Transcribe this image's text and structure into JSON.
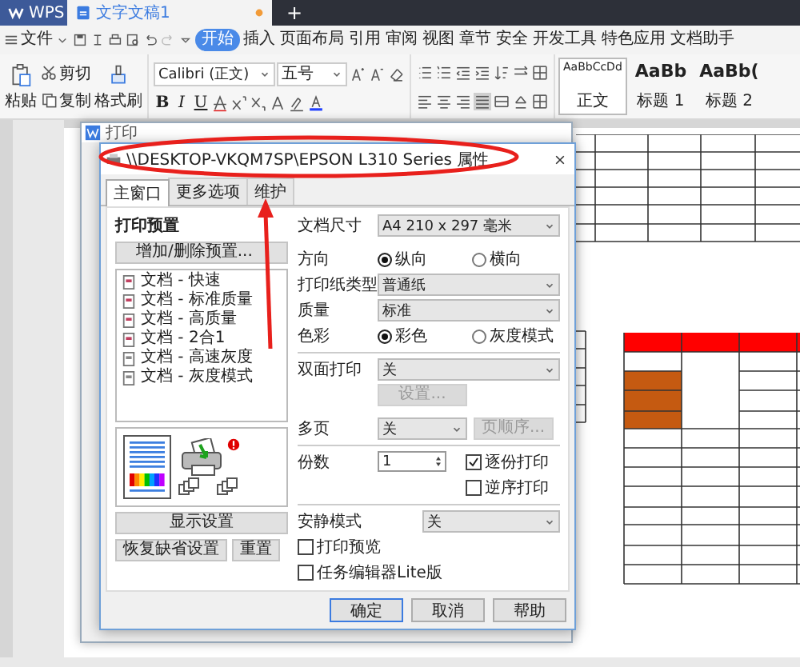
{
  "app_tabs": [
    {
      "label": "WPS",
      "kind": "home",
      "selected": false
    },
    {
      "label": "文字文稿1",
      "kind": "document",
      "selected": true,
      "unsaved": true
    }
  ],
  "new_tab": "+",
  "menu": {
    "file": "文件",
    "items": [
      {
        "label": "开始",
        "selected": true
      },
      {
        "label": "插入",
        "selected": false
      },
      {
        "label": "页面布局",
        "selected": false
      },
      {
        "label": "引用",
        "selected": false
      },
      {
        "label": "审阅",
        "selected": false
      },
      {
        "label": "视图",
        "selected": false
      },
      {
        "label": "章节",
        "selected": false
      },
      {
        "label": "安全",
        "selected": false
      },
      {
        "label": "开发工具",
        "selected": false
      },
      {
        "label": "特色应用",
        "selected": false
      },
      {
        "label": "文档助手",
        "selected": false
      }
    ]
  },
  "ribbon": {
    "paste": "粘贴",
    "cut": "剪切",
    "copy": "复制",
    "format_painter": "格式刷",
    "font": "Calibri (正文)",
    "size": "五号",
    "format_letters": [
      "B",
      "I",
      "U"
    ],
    "styles": [
      {
        "sample": "AaBbCcDd",
        "name": "正文",
        "selected": true
      },
      {
        "sample": "AaBb",
        "name": "标题 1",
        "selected": false
      },
      {
        "sample": "AaBb(",
        "name": "标题 2",
        "selected": false
      }
    ]
  },
  "back_dialog": {
    "title": "打印"
  },
  "dialog": {
    "title": "\\\\DESKTOP-VKQM7SP\\EPSON L310 Series 属性",
    "tabs": [
      {
        "label": "主窗口",
        "selected": true
      },
      {
        "label": "更多选项",
        "selected": false
      },
      {
        "label": "维护",
        "selected": false
      }
    ],
    "presets": {
      "label": "打印预置",
      "add_button": "增加/删除预置...",
      "items": [
        "文档 - 快速",
        "文档 - 标准质量",
        "文档 - 高质量",
        "文档 - 2合1",
        "文档 - 高速灰度",
        "文档 - 灰度模式"
      ]
    },
    "left_buttons": [
      "显示设置",
      "恢复缺省设置",
      "重置"
    ],
    "paper_size": {
      "label": "文档尺寸",
      "value": "A4 210 x 297 毫米"
    },
    "orientation": {
      "label": "方向",
      "options": [
        {
          "label": "纵向",
          "selected": true
        },
        {
          "label": "横向",
          "selected": false
        }
      ]
    },
    "paper_type": {
      "label": "打印纸类型",
      "value": "普通纸"
    },
    "quality": {
      "label": "质量",
      "value": "标准"
    },
    "color": {
      "label": "色彩",
      "options": [
        {
          "label": "彩色",
          "selected": true
        },
        {
          "label": "灰度模式",
          "selected": false
        }
      ]
    },
    "duplex": {
      "label": "双面打印",
      "value": "关",
      "button": {
        "label": "设置...",
        "disabled": true
      }
    },
    "multipage": {
      "label": "多页",
      "value": "关",
      "button": {
        "label": "页顺序...",
        "disabled": true
      }
    },
    "copies": {
      "label": "份数",
      "value": "1"
    },
    "copy_options": [
      {
        "label": "逐份打印",
        "checked": true
      },
      {
        "label": "逆序打印",
        "checked": false
      }
    ],
    "quiet": {
      "label": "安静模式",
      "value": "关"
    },
    "extra_options": [
      {
        "label": "打印预览",
        "checked": false
      },
      {
        "label": "任务编辑器Lite版",
        "checked": false
      }
    ],
    "buttons": [
      {
        "label": "确定",
        "default": true
      },
      {
        "label": "取消",
        "default": false
      },
      {
        "label": "帮助",
        "default": false
      }
    ]
  }
}
